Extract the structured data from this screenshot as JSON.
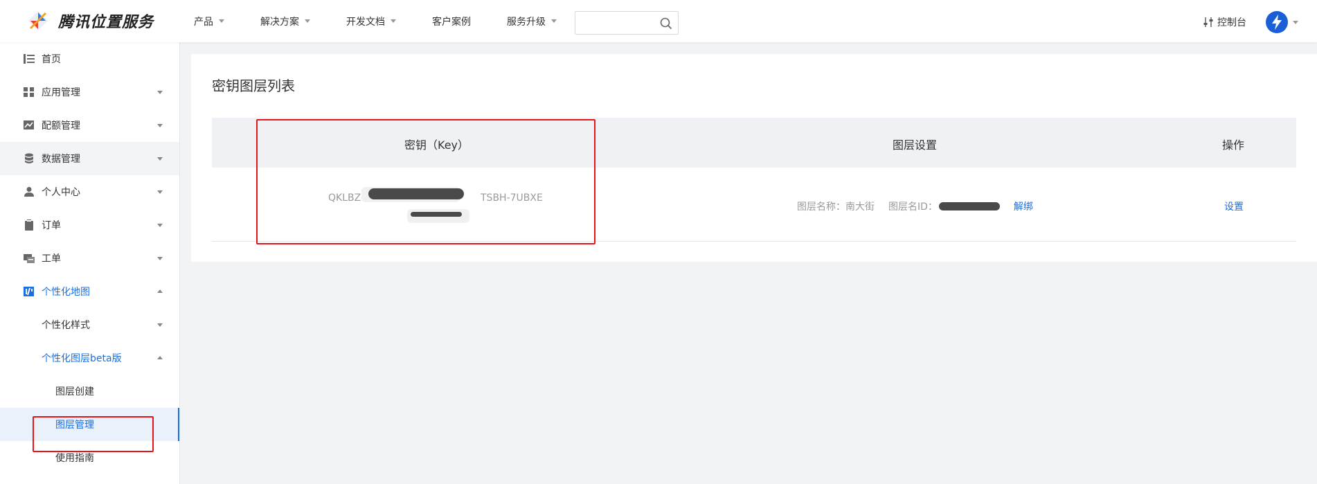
{
  "brand": {
    "name": "腾讯位置服务"
  },
  "nav": {
    "items": [
      {
        "label": "产品",
        "has_caret": true
      },
      {
        "label": "解决方案",
        "has_caret": true
      },
      {
        "label": "开发文档",
        "has_caret": true
      },
      {
        "label": "客户案例",
        "has_caret": false
      },
      {
        "label": "服务升级",
        "has_caret": true
      }
    ],
    "search": {
      "value": "",
      "placeholder": ""
    },
    "console_label": "控制台"
  },
  "sidebar": {
    "items": [
      {
        "label": "首页",
        "icon": "list-icon"
      },
      {
        "label": "应用管理",
        "icon": "grid-icon"
      },
      {
        "label": "配额管理",
        "icon": "chart-icon"
      },
      {
        "label": "数据管理",
        "icon": "database-icon"
      },
      {
        "label": "个人中心",
        "icon": "user-icon"
      },
      {
        "label": "订单",
        "icon": "clipboard-icon"
      },
      {
        "label": "工单",
        "icon": "ticket-icon"
      },
      {
        "label": "个性化地图",
        "icon": "custom-map-icon"
      },
      {
        "label": "个性化样式"
      },
      {
        "label": "个性化图层beta版"
      },
      {
        "label": "图层创建"
      },
      {
        "label": "图层管理"
      },
      {
        "label": "使用指南"
      }
    ]
  },
  "main": {
    "title": "密钥图层列表",
    "table": {
      "headers": [
        "密钥（Key）",
        "图层设置",
        "操作"
      ],
      "row": {
        "key_prefix": "QKLBZ-",
        "key_suffix": "TSBH-7UBXE",
        "layer_name_label": "图层名称：",
        "layer_name": "南大街",
        "layer_id_label": "图层名ID：",
        "unbind_label": "解绑",
        "settings_label": "设置"
      }
    }
  },
  "colors": {
    "accent": "#1a6fe0",
    "highlight": "#e8141b"
  }
}
